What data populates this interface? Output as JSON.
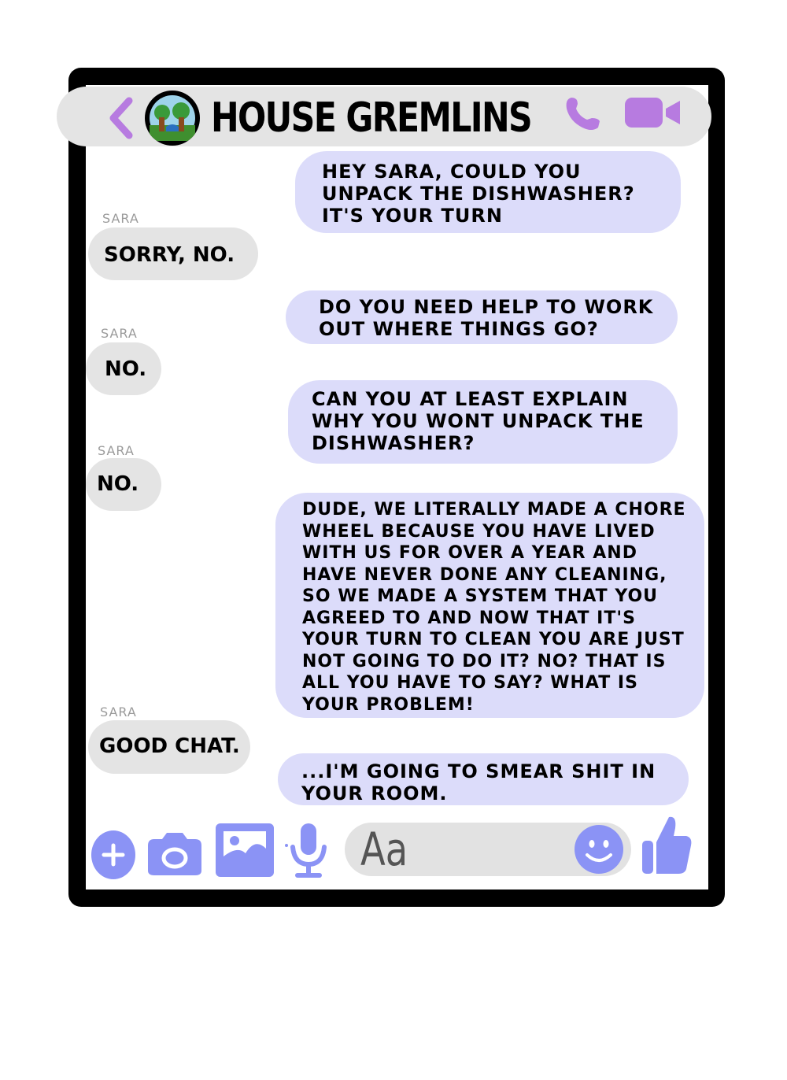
{
  "header": {
    "title": "HOUSE GREMLINS"
  },
  "messages": [
    {
      "direction": "outgoing",
      "text": "HEY SARA, COULD YOU UNPACK THE DISHWASHER? IT'S YOUR TURN"
    },
    {
      "direction": "incoming",
      "sender": "SARA",
      "text": "SORRY, NO."
    },
    {
      "direction": "outgoing",
      "text": "DO YOU NEED HELP TO WORK OUT WHERE THINGS GO?"
    },
    {
      "direction": "incoming",
      "sender": "SARA",
      "text": "NO."
    },
    {
      "direction": "outgoing",
      "text": "CAN YOU AT LEAST EXPLAIN WHY YOU WONT UNPACK THE DISHWASHER?"
    },
    {
      "direction": "incoming",
      "sender": "SARA",
      "text": "NO."
    },
    {
      "direction": "outgoing",
      "text": "DUDE, WE LITERALLY MADE A CHORE WHEEL BECAUSE YOU HAVE LIVED WITH US FOR OVER A YEAR AND HAVE NEVER DONE ANY CLEANING, SO WE MADE A SYSTEM THAT YOU AGREED TO AND NOW THAT IT'S YOUR TURN TO CLEAN YOU ARE JUST NOT GOING TO DO IT? NO? THAT IS ALL YOU HAVE TO SAY? WHAT IS YOUR PROBLEM!"
    },
    {
      "direction": "incoming",
      "sender": "SARA",
      "text": "GOOD CHAT."
    },
    {
      "direction": "outgoing",
      "text": "...I'M GOING TO SMEAR SHIT IN YOUR ROOM."
    }
  ],
  "composer": {
    "placeholder": "Aa"
  },
  "colors": {
    "accent": "#8b93f5",
    "header_icons": "#b77be0",
    "outgoing_bubble": "#dcdcfa",
    "incoming_bubble": "#e4e4e4",
    "frame": "#000000"
  },
  "icons": {
    "back": "chevron-left-icon",
    "avatar": "group-avatar",
    "call": "phone-icon",
    "video": "video-camera-icon",
    "add": "plus-circle-icon",
    "camera": "camera-icon",
    "gallery": "image-icon",
    "voice": "microphone-icon",
    "emoji": "smiley-icon",
    "like": "thumbs-up-icon"
  }
}
